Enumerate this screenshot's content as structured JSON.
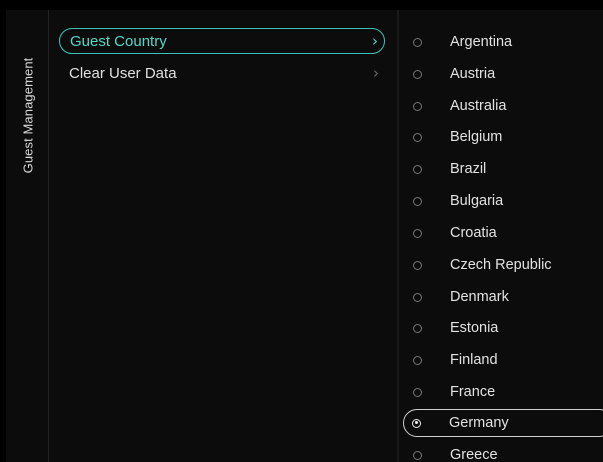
{
  "section": {
    "title": "Guest Management"
  },
  "menu": {
    "items": [
      {
        "label": "Guest Country",
        "selected": true
      },
      {
        "label": "Clear User Data",
        "selected": false
      }
    ],
    "chevron": "chevron-right-icon"
  },
  "countries": {
    "items": [
      {
        "label": "Argentina",
        "checked": false
      },
      {
        "label": "Austria",
        "checked": false
      },
      {
        "label": "Australia",
        "checked": false
      },
      {
        "label": "Belgium",
        "checked": false
      },
      {
        "label": "Brazil",
        "checked": false
      },
      {
        "label": "Bulgaria",
        "checked": false
      },
      {
        "label": "Croatia",
        "checked": false
      },
      {
        "label": "Czech Republic",
        "checked": false
      },
      {
        "label": "Denmark",
        "checked": false
      },
      {
        "label": "Estonia",
        "checked": false
      },
      {
        "label": "Finland",
        "checked": false
      },
      {
        "label": "France",
        "checked": false
      },
      {
        "label": "Germany",
        "checked": true
      },
      {
        "label": "Greece",
        "checked": false
      }
    ]
  },
  "colors": {
    "accent": "#3fc3b3",
    "background": "#0c0c0c",
    "text": "#e2e2e2"
  }
}
